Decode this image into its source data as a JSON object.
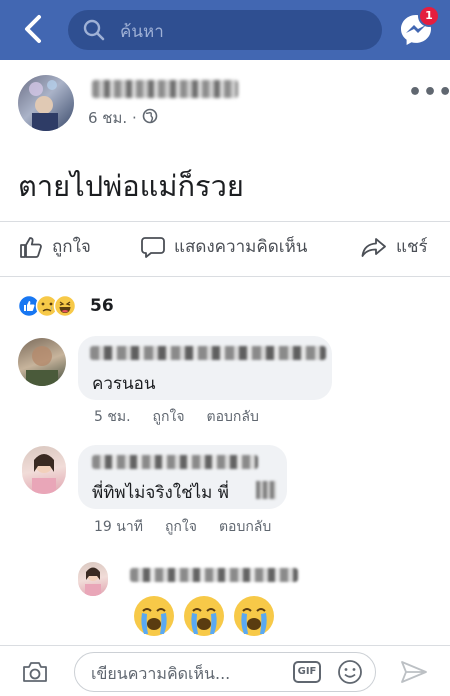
{
  "header": {
    "search_placeholder": "ค้นหา",
    "messenger_badge": "1",
    "colors": {
      "bar": "#4267b2",
      "badge": "#e41e3f"
    }
  },
  "post": {
    "time": "6 ชม.",
    "separator": "·",
    "text": "ตายไปพ่อแม่ก็รวย",
    "more_label": "•••"
  },
  "actions": {
    "like_label": "ถูกใจ",
    "comment_label": "แสดงความคิดเห็น",
    "share_label": "แชร์"
  },
  "reactions": {
    "count": "56",
    "icons": [
      "like-icon",
      "sad-icon",
      "haha-icon"
    ]
  },
  "comments": [
    {
      "text": "ควรนอน",
      "time": "5 ชม.",
      "like_label": "ถูกใจ",
      "reply_label": "ตอบกลับ"
    },
    {
      "text": "พี่ทิพไม่จริงใช่ไม พี่",
      "time": "19 นาที",
      "like_label": "ถูกใจ",
      "reply_label": "ตอบกลับ"
    },
    {
      "emojis": [
        "crying-face-icon",
        "crying-face-icon",
        "crying-face-icon"
      ]
    }
  ],
  "composer": {
    "placeholder": "เขียนความคิดเห็น...",
    "gif_label": "GIF"
  }
}
